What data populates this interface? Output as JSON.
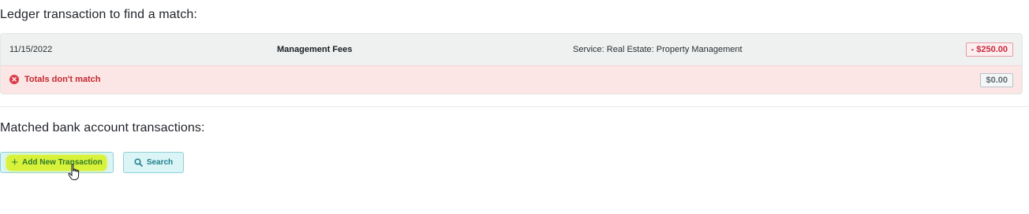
{
  "ledger": {
    "title": "Ledger transaction to find a match:",
    "transaction": {
      "date": "11/15/2022",
      "name": "Management Fees",
      "category": "Service: Real Estate: Property Management",
      "amount": "- $250.00"
    },
    "status": {
      "icon": "error-x-icon",
      "message": "Totals don't match",
      "total": "$0.00"
    }
  },
  "matched": {
    "title": "Matched bank account transactions:",
    "add_button_label": "Add New Transaction",
    "search_button_label": "Search"
  },
  "colors": {
    "error": "#c3272f",
    "error_background": "#fbe5e5",
    "button_background": "#dbf4f6",
    "highlight": "#d8f23a"
  }
}
